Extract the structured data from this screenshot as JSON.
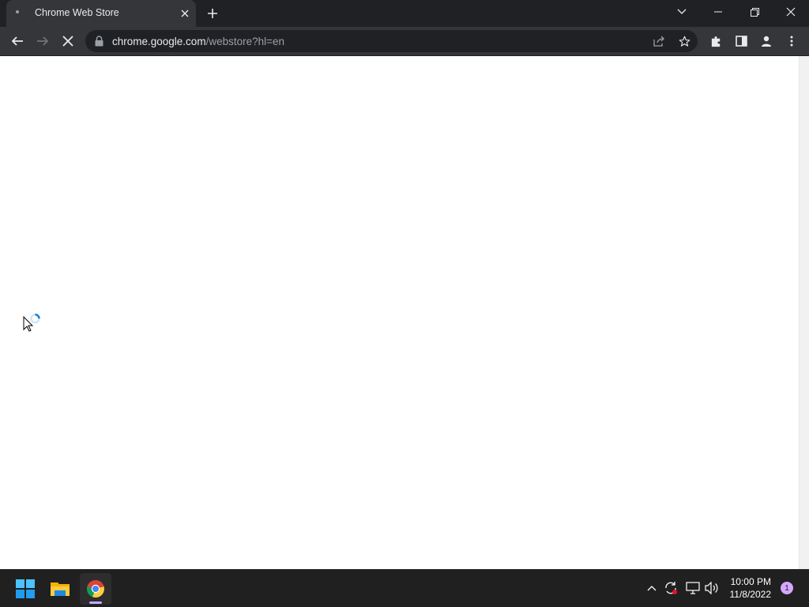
{
  "browser": {
    "tab": {
      "title": "Chrome Web Store"
    },
    "url": {
      "host": "chrome.google.com",
      "path": "/webstore?hl=en"
    },
    "icons": {
      "back": "arrow-left-icon",
      "forward": "arrow-right-icon",
      "stop": "stop-loading-icon",
      "lock": "lock-icon",
      "share": "share-icon",
      "bookmark": "star-icon",
      "extensions": "puzzle-icon",
      "side_panel": "side-panel-icon",
      "profile": "profile-icon",
      "menu": "kebab-menu-icon"
    }
  },
  "taskbar": {
    "clock": {
      "time": "10:00 PM",
      "date": "11/8/2022"
    },
    "notification_count": "1",
    "apps": [
      "windows-start",
      "file-explorer",
      "google-chrome"
    ]
  },
  "colors": {
    "titlebar": "#202124",
    "toolbar": "#35363a",
    "taskbar": "#202020",
    "accent": "#c9a6ff"
  }
}
